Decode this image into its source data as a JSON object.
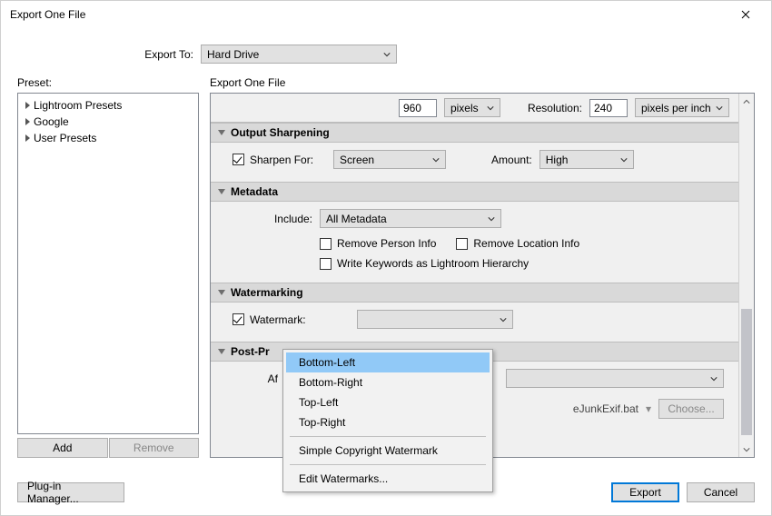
{
  "window": {
    "title": "Export One File"
  },
  "export_to": {
    "label": "Export To:",
    "value": "Hard Drive"
  },
  "preset": {
    "label": "Preset:",
    "items": [
      "Lightroom Presets",
      "Google",
      "User Presets"
    ],
    "add_label": "Add",
    "remove_label": "Remove"
  },
  "right": {
    "label": "Export One File",
    "top": {
      "dim_value": "960",
      "dim_unit": "pixels",
      "resolution_label": "Resolution:",
      "resolution_value": "240",
      "resolution_unit": "pixels per inch"
    },
    "sharpening": {
      "header": "Output Sharpening",
      "sharpen_for_label": "Sharpen For:",
      "sharpen_for_value": "Screen",
      "amount_label": "Amount:",
      "amount_value": "High"
    },
    "metadata": {
      "header": "Metadata",
      "include_label": "Include:",
      "include_value": "All Metadata",
      "remove_person": "Remove Person Info",
      "remove_location": "Remove Location Info",
      "write_keywords": "Write Keywords as Lightroom Hierarchy"
    },
    "watermarking": {
      "header": "Watermarking",
      "checkbox_label": "Watermark:",
      "options": {
        "bl": "Bottom-Left",
        "br": "Bottom-Right",
        "tl": "Top-Left",
        "tr": "Top-Right",
        "simple": "Simple Copyright Watermark",
        "edit": "Edit Watermarks..."
      }
    },
    "post": {
      "header_truncated": "Post-Pr",
      "after_label_truncated": "Af",
      "path_fragment": "eJunkExif.bat",
      "choose_label": "Choose..."
    }
  },
  "footer": {
    "plugin_label": "Plug-in Manager...",
    "export_label": "Export",
    "cancel_label": "Cancel"
  }
}
